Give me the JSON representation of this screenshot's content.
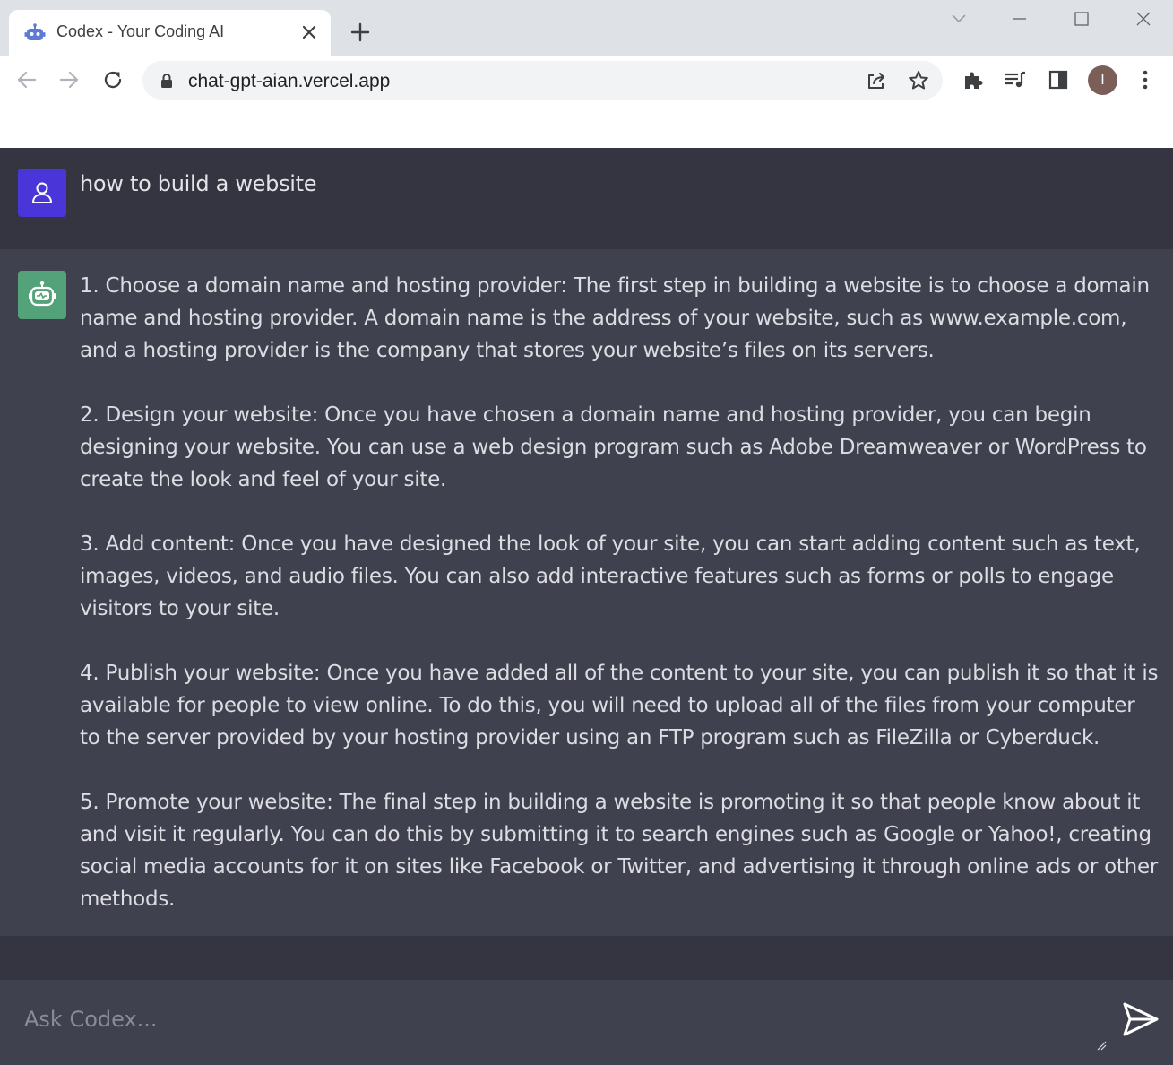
{
  "browser": {
    "tab_title": "Codex - Your Coding AI",
    "url": "chat-gpt-aian.vercel.app",
    "profile_initial": "I"
  },
  "icons": {
    "favicon": "robot-icon",
    "tab_close": "close-icon",
    "new_tab": "plus-icon",
    "window": [
      "chevron-down-icon",
      "minimize-icon",
      "maximize-icon",
      "close-icon"
    ],
    "nav": [
      "back-arrow-icon",
      "forward-arrow-icon",
      "reload-icon"
    ],
    "omnibox": [
      "lock-icon",
      "share-icon",
      "star-icon"
    ],
    "toolbar": [
      "puzzle-icon",
      "media-queue-icon",
      "side-panel-icon",
      "kebab-menu-icon"
    ],
    "user_avatar": "user-icon",
    "ai_avatar": "robot-icon",
    "send": "send-icon"
  },
  "colors": {
    "user_avatar_bg": "#4a36d8",
    "ai_avatar_bg": "#54a27a",
    "page_bg": "#343541",
    "ai_message_bg": "#40414f"
  },
  "chat": {
    "user_message": "how to build a website",
    "ai_response": [
      "1. Choose a domain name and hosting provider: The first step in building a website is to choose a domain name and hosting provider. A domain name is the address of your website, such as www.example.com, and a hosting provider is the company that stores your website’s files on its servers.",
      "2. Design your website: Once you have chosen a domain name and hosting provider, you can begin designing your website. You can use a web design program such as Adobe Dreamweaver or WordPress to create the look and feel of your site.",
      "3. Add content: Once you have designed the look of your site, you can start adding content such as text, images, videos, and audio files. You can also add interactive features such as forms or polls to engage visitors to your site.",
      "4. Publish your website: Once you have added all of the content to your site, you can publish it so that it is available for people to view online. To do this, you will need to upload all of the files from your computer to the server provided by your hosting provider using an FTP program such as FileZilla or Cyberduck.",
      "5. Promote your website: The final step in building a website is promoting it so that people know about it and visit it regularly. You can do this by submitting it to search engines such as Google or Yahoo!, creating social media accounts for it on sites like Facebook or Twitter, and advertising it through online ads or other methods."
    ]
  },
  "composer": {
    "placeholder": "Ask Codex..."
  }
}
